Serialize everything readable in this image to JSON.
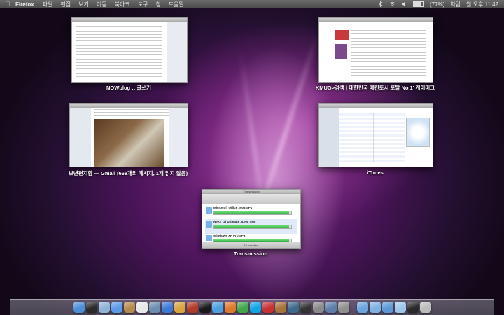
{
  "menubar": {
    "apple": "",
    "app_name": "Firefox",
    "menus": [
      "파일",
      "편집",
      "보기",
      "이동",
      "북마크",
      "도구",
      "창",
      "도움말"
    ],
    "battery_text": "(77%)",
    "battery_level": 0.77,
    "user": "차람",
    "clock": "월 오후 11:42"
  },
  "windows": {
    "nowblog": {
      "label": "NOWblog :: 글쓰기"
    },
    "kmug": {
      "label": "KMUG>검색 | 대한민국 매킨토시 포탈 No.1' 케이머그"
    },
    "gmail": {
      "label": "보낸편지함 — Gmail (668개의 메시지, 1개 읽지 않음)"
    },
    "itunes": {
      "label": "iTunes"
    },
    "transmission": {
      "label": "Transmission",
      "title": "Transmission",
      "torrents": [
        {
          "name": "Microsoft Office 2008 SP1",
          "progress": 0.97
        },
        {
          "name": "NeXT (2) Ultimate 3DPE SH5",
          "progress": 0.97
        },
        {
          "name": "Windows XP Pro SP3",
          "progress": 0.97
        }
      ],
      "footer": "10 transfers"
    }
  },
  "dock": {
    "icons": [
      {
        "name": "finder-icon",
        "color": "#4c8fd6"
      },
      {
        "name": "dashboard-icon",
        "color": "#2b2b2b"
      },
      {
        "name": "mail-icon",
        "color": "#8fb4d8"
      },
      {
        "name": "ichat-icon",
        "color": "#5b9ae8"
      },
      {
        "name": "address-book-icon",
        "color": "#b68a4e"
      },
      {
        "name": "ical-icon",
        "color": "#e8e8e8"
      },
      {
        "name": "iphoto-icon",
        "color": "#6b8fb0"
      },
      {
        "name": "itunes-icon",
        "color": "#3c7ad8"
      },
      {
        "name": "garageband-icon",
        "color": "#d9a441"
      },
      {
        "name": "photo-booth-icon",
        "color": "#b33a2a"
      },
      {
        "name": "terminal-icon",
        "color": "#1a1a1a"
      },
      {
        "name": "safari-icon",
        "color": "#4aa0e0"
      },
      {
        "name": "firefox-icon",
        "color": "#e07a2a"
      },
      {
        "name": "chrome-icon",
        "color": "#3fa64a"
      },
      {
        "name": "skype-icon",
        "color": "#12a5e4"
      },
      {
        "name": "transmission-icon",
        "color": "#c83232"
      },
      {
        "name": "guitar-icon",
        "color": "#a8733a"
      },
      {
        "name": "time-machine-icon",
        "color": "#3b6a8a"
      },
      {
        "name": "dvd-player-icon",
        "color": "#333333"
      },
      {
        "name": "preview-icon",
        "color": "#8a8a8a"
      },
      {
        "name": "xcode-icon",
        "color": "#5c7ea8"
      },
      {
        "name": "system-preferences-icon",
        "color": "#909090"
      }
    ],
    "right_icons": [
      {
        "name": "applications-folder-icon",
        "color": "#6aa6e0"
      },
      {
        "name": "documents-folder-icon",
        "color": "#7fb2e4"
      },
      {
        "name": "downloads-folder-icon",
        "color": "#5c98d6"
      },
      {
        "name": "stack-icon",
        "color": "#9ec6ec"
      },
      {
        "name": "iphone-icon",
        "color": "#2a2a2a"
      },
      {
        "name": "trash-icon",
        "color": "#bcbcbc"
      }
    ]
  }
}
